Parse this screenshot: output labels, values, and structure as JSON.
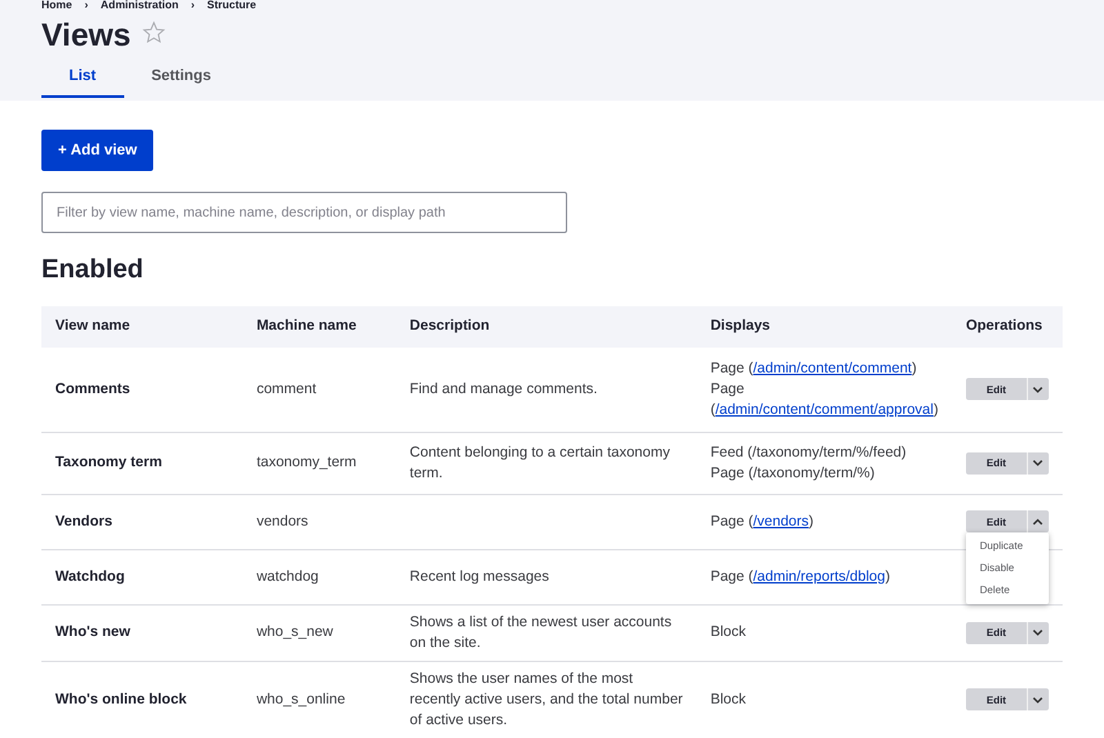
{
  "breadcrumb": {
    "items": [
      "Home",
      "Administration",
      "Structure"
    ],
    "separator": "›"
  },
  "page_title": "Views",
  "favorite": {
    "on": false
  },
  "tabs": [
    {
      "label": "List",
      "selected": true
    },
    {
      "label": "Settings",
      "selected": false
    }
  ],
  "add_button": "+ Add view",
  "filter": {
    "placeholder": "Filter by view name, machine name, description, or display path"
  },
  "section_title": "Enabled",
  "table": {
    "columns": [
      "View name",
      "Machine name",
      "Description",
      "Displays",
      "Operations"
    ],
    "rows": [
      {
        "name": "Comments",
        "machine": "comment",
        "description": "Find and manage comments.",
        "displays": [
          {
            "prefix": "Page (",
            "link": "/admin/content/comment",
            "suffix": ")"
          },
          {
            "prefix": "Page (",
            "link": "/admin/content/comment/approval",
            "suffix": ")"
          }
        ],
        "operations": {
          "edit": "Edit",
          "expanded": false
        }
      },
      {
        "name": "Taxonomy term",
        "machine": "taxonomy_term",
        "description": "Content belonging to a certain taxonomy term.",
        "displays": [
          {
            "prefix": "Feed (/taxonomy/term/%/feed)"
          },
          {
            "prefix": "Page (/taxonomy/term/%)"
          }
        ],
        "operations": {
          "edit": "Edit",
          "expanded": false
        }
      },
      {
        "name": "Vendors",
        "machine": "vendors",
        "displays": [
          {
            "prefix": "Page (",
            "link": "/vendors",
            "suffix": ")"
          }
        ],
        "operations": {
          "edit": "Edit",
          "expanded": true,
          "menu": [
            "Duplicate",
            "Disable",
            "Delete"
          ]
        }
      },
      {
        "name": "Watchdog",
        "machine": "watchdog",
        "description": "Recent log messages",
        "displays": [
          {
            "prefix": "Page (",
            "link": "/admin/reports/dblog",
            "suffix": ")"
          }
        ]
      },
      {
        "name": "Who's new",
        "machine": "who_s_new",
        "description": "Shows a list of the newest user accounts on the site.",
        "displays": [
          {
            "prefix": "Block"
          }
        ],
        "operations": {
          "edit": "Edit",
          "expanded": false
        }
      },
      {
        "name": "Who's online block",
        "machine": "who_s_online",
        "description": "Shows the user names of the most recently active users, and the total number of active users.",
        "displays": [
          {
            "prefix": "Block"
          }
        ],
        "operations": {
          "edit": "Edit",
          "expanded": false
        }
      }
    ]
  }
}
